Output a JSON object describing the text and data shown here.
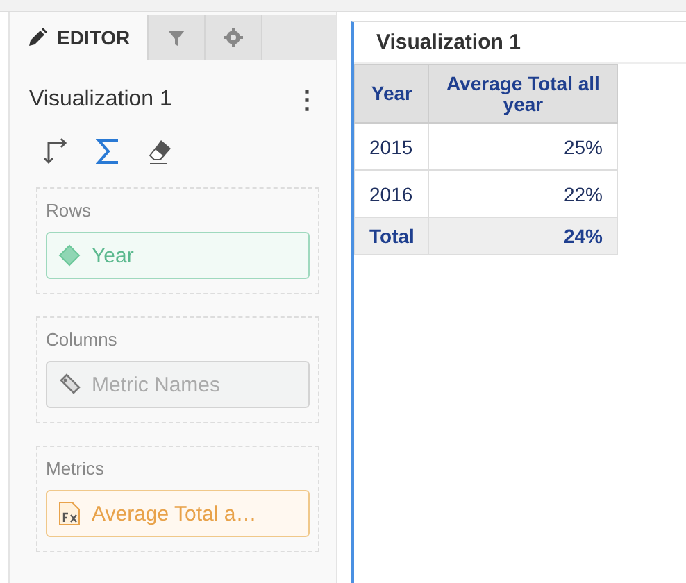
{
  "tabs": [
    {
      "kind": "editor",
      "label": "EDITOR",
      "selected": true
    },
    {
      "kind": "filter",
      "selected": false
    },
    {
      "kind": "settings",
      "selected": false
    }
  ],
  "editor": {
    "title": "Visualization 1",
    "menu": "⋮",
    "tools": [
      {
        "kind": "pivot",
        "selected": false
      },
      {
        "kind": "sum",
        "selected": true
      },
      {
        "kind": "eraser",
        "selected": false
      }
    ]
  },
  "shelves": [
    {
      "label": "Rows",
      "item": {
        "kind": "dimension",
        "text": "Year"
      }
    },
    {
      "label": "Columns",
      "item": {
        "kind": "metric_names",
        "text": "Metric Names"
      }
    },
    {
      "label": "Metrics",
      "item": {
        "kind": "metric",
        "text": "Average Total a…"
      }
    }
  ],
  "visualization": {
    "title": "Visualization 1",
    "table": {
      "columns": [
        "Year",
        "Average Total all year"
      ],
      "rows": [
        [
          "2015",
          "25%"
        ],
        [
          "2016",
          "22%"
        ]
      ],
      "total": [
        "Total",
        "24%"
      ]
    }
  }
}
